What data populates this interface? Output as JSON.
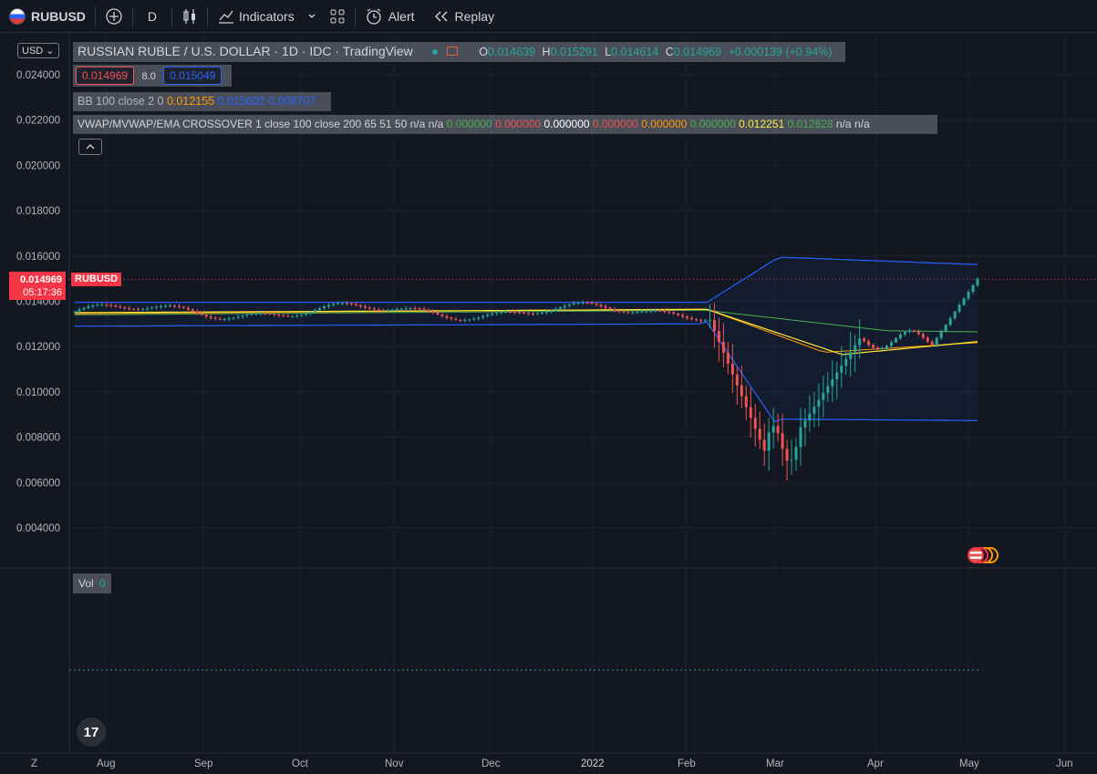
{
  "toolbar": {
    "symbol": "RUBUSD",
    "interval": "D",
    "indicators_label": "Indicators",
    "alert_label": "Alert",
    "replay_label": "Replay"
  },
  "legend": {
    "title": "RUSSIAN RUBLE / U.S. DOLLAR · 1D · IDC · TradingView",
    "open_label": "O",
    "open": "0.014639",
    "high_label": "H",
    "high": "0.015291",
    "low_label": "L",
    "low": "0.014614",
    "close_label": "C",
    "close": "0.014969",
    "change": "+0.000139 (+0.94%)",
    "bid": "0.014969",
    "spread": "8.0",
    "ask": "0.015049",
    "bb_label": "BB 100 close 2 0",
    "bb_basis": "0.012155",
    "bb_upper": "0.015602",
    "bb_lower": "0.008707",
    "cross_label": "VWAP/MVWAP/EMA CROSSOVER 1 close 100 close 200 65 51 50",
    "cross_vals": [
      "n/a",
      "n/a",
      "0.000000",
      "0.000000",
      "0.000000",
      "0.000000",
      "0.000000",
      "0.000000",
      "0.012251",
      "0.012628",
      "n/a",
      "n/a"
    ]
  },
  "price_axis": {
    "currency": "USD",
    "ticks": [
      "0.024000",
      "0.022000",
      "0.020000",
      "0.018000",
      "0.016000",
      "0.014000",
      "0.012000",
      "0.010000",
      "0.008000",
      "0.006000",
      "0.004000"
    ],
    "last_price": "0.014969",
    "countdown": "05:17:36",
    "symbol_tag": "RUBUSD"
  },
  "time_axis": {
    "corner": "Z",
    "labels": [
      "Aug",
      "Sep",
      "Oct",
      "Nov",
      "Dec",
      "2022",
      "Feb",
      "Mar",
      "Apr",
      "May",
      "Jun"
    ]
  },
  "volume": {
    "label": "Vol",
    "value": "0"
  },
  "logo": "17",
  "colors": {
    "background": "#131722",
    "up": "#26a69a",
    "down": "#ef5350",
    "bb_band": "#2962ff",
    "basis": "#ff9800",
    "ema_yellow": "#ffeb3b",
    "ema_green": "#4caf50",
    "last_price": "#f23645"
  }
}
